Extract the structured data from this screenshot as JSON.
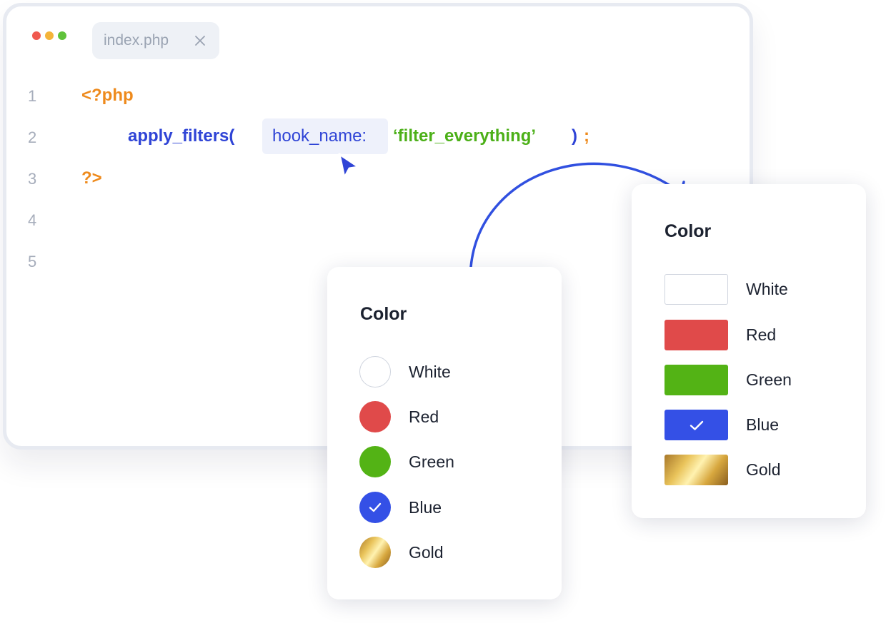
{
  "editor": {
    "tab_label": "index.php",
    "line_numbers": [
      "1",
      "2",
      "3",
      "4",
      "5"
    ],
    "code": {
      "open_tag": "<?php",
      "function": "apply_filters(",
      "param_name": "hook_name:",
      "param_value": "‘filter_everything’",
      "close_paren": ")",
      "semicolon": ";",
      "close_tag": "?>"
    }
  },
  "cards": {
    "radio": {
      "title": "Color",
      "options": [
        {
          "label": "White",
          "color": "#ffffff",
          "selected": false
        },
        {
          "label": "Red",
          "color": "#e04a4a",
          "selected": false
        },
        {
          "label": "Green",
          "color": "#53b315",
          "selected": false
        },
        {
          "label": "Blue",
          "color": "#3450e6",
          "selected": true
        },
        {
          "label": "Gold",
          "color": "gold-gradient",
          "selected": false
        }
      ]
    },
    "swatch": {
      "title": "Color",
      "options": [
        {
          "label": "White",
          "color": "#ffffff",
          "selected": false
        },
        {
          "label": "Red",
          "color": "#e04a4a",
          "selected": false
        },
        {
          "label": "Green",
          "color": "#53b315",
          "selected": false
        },
        {
          "label": "Blue",
          "color": "#3450e6",
          "selected": true
        },
        {
          "label": "Gold",
          "color": "gold-gradient",
          "selected": false
        }
      ]
    }
  },
  "colors": {
    "accent_blue": "#2f44d6",
    "php_tag": "#ee8a1c",
    "string": "#4cb018",
    "window_red": "#f0594f",
    "window_yellow": "#f4b43a",
    "window_green": "#5fc23a"
  },
  "icons": [
    "close-icon",
    "cursor-icon",
    "checkmark-icon",
    "curved-arrow-icon"
  ]
}
